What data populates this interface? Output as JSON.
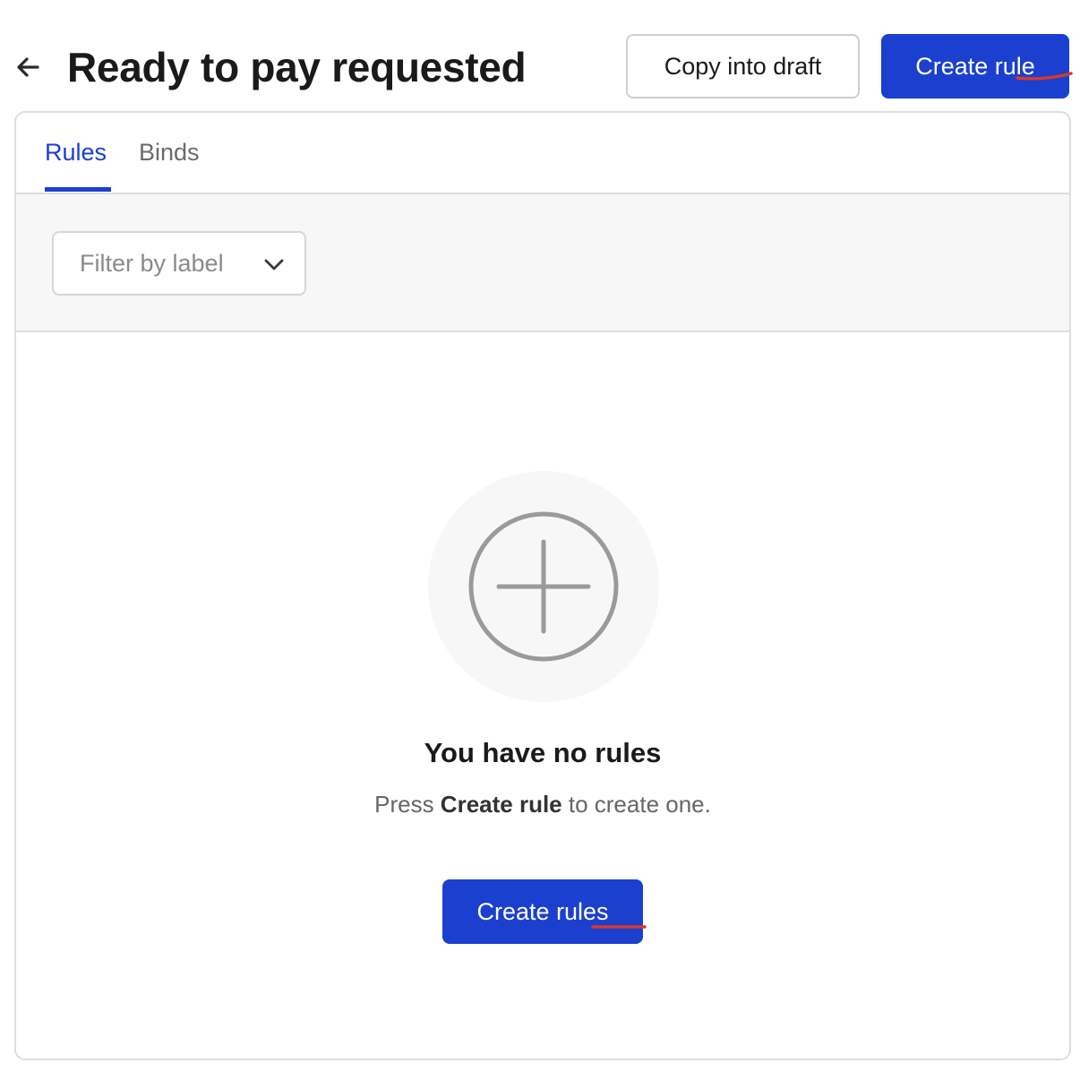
{
  "colors": {
    "accent": "#1b3fcf",
    "annotation_red": "#d9382c"
  },
  "header": {
    "back_icon": "arrow-left-icon",
    "title": "Ready to pay requested",
    "copy_button_label": "Copy into draft",
    "create_button_label": "Create rule"
  },
  "tabs": [
    {
      "label": "Rules",
      "active": true
    },
    {
      "label": "Binds",
      "active": false
    }
  ],
  "filter": {
    "placeholder": "Filter by label",
    "icon": "chevron-down-icon"
  },
  "empty_state": {
    "icon": "plus-circle-icon",
    "title": "You have no rules",
    "description_prefix": "Press ",
    "description_emphasis": "Create rule",
    "description_suffix": " to create one.",
    "button_label": "Create rules"
  }
}
